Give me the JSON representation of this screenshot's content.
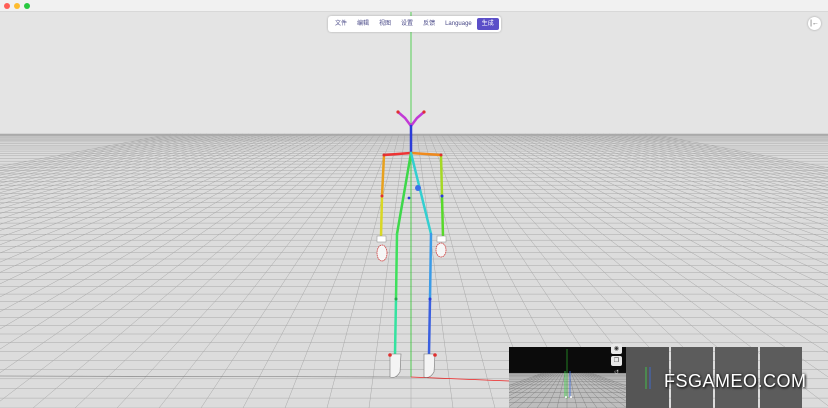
{
  "window": {
    "controls": [
      {
        "name": "close",
        "color": "#ff5f57"
      },
      {
        "name": "minimize",
        "color": "#febc2e"
      },
      {
        "name": "maximize",
        "color": "#28c840"
      }
    ]
  },
  "menu": {
    "items": [
      {
        "label": "文件"
      },
      {
        "label": "编辑"
      },
      {
        "label": "视图"
      },
      {
        "label": "设置"
      },
      {
        "label": "反馈"
      },
      {
        "label": "Language"
      },
      {
        "label": "生成"
      }
    ],
    "active_index": 6
  },
  "sidebar_toggle": {
    "icon": "panel-collapse-icon",
    "glyph": "|←"
  },
  "preview": {
    "controls": [
      {
        "icon": "eye-icon",
        "glyph": "◉"
      },
      {
        "icon": "copy-icon",
        "glyph": "❐"
      },
      {
        "icon": "refresh-icon",
        "glyph": "↺"
      }
    ],
    "thumbnail_count": 4
  },
  "watermark": {
    "text": "FSGAMEO.COM"
  },
  "colors": {
    "accent": "#5b4fc8",
    "floor": "#dedede",
    "grid": "#a8a8a8",
    "axis_y": "#33cc33",
    "axis_x": "#ee2222"
  }
}
